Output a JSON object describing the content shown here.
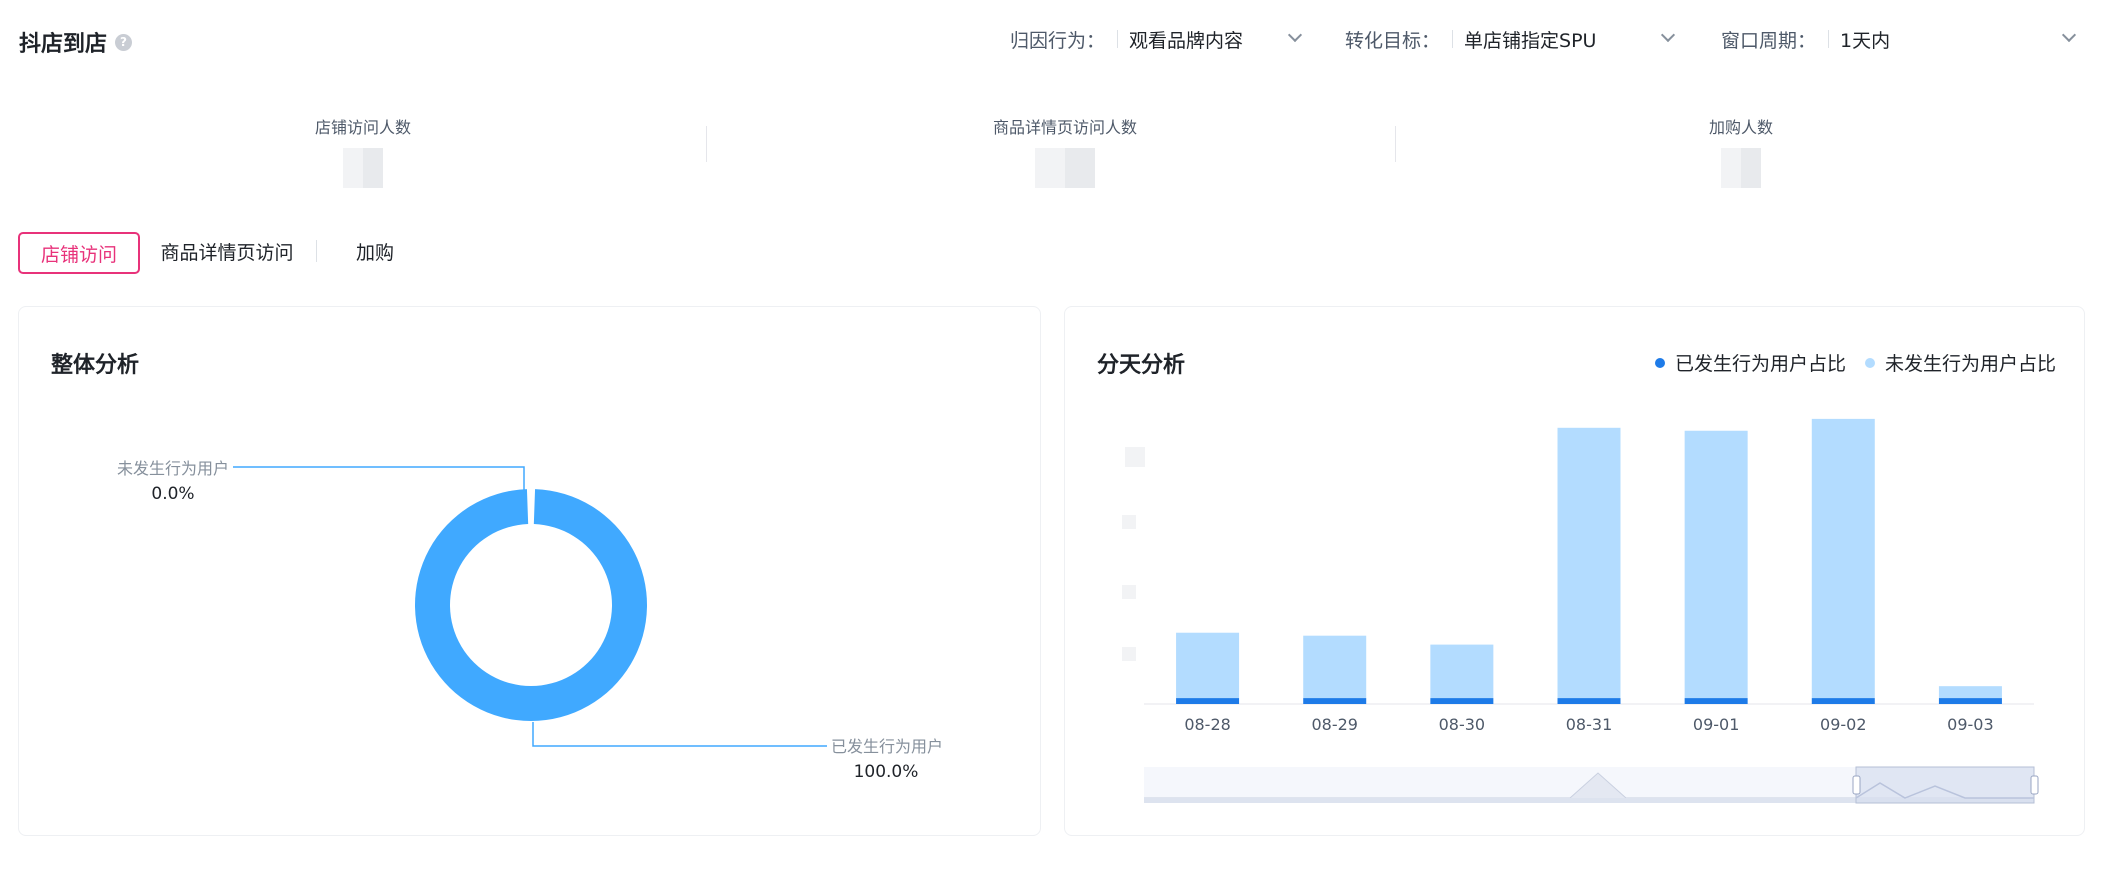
{
  "header": {
    "title": "抖店到店",
    "help_icon": "question-circle-icon"
  },
  "filters": [
    {
      "label": "归因行为：",
      "value": "观看品牌内容"
    },
    {
      "label": "转化目标：",
      "value": "单店铺指定SPU"
    },
    {
      "label": "窗口周期：",
      "value": "1天内"
    }
  ],
  "metrics": [
    {
      "label": "店铺访问人数"
    },
    {
      "label": "商品详情页访问人数"
    },
    {
      "label": "加购人数"
    }
  ],
  "tabs": [
    {
      "label": "店铺访问",
      "active": true
    },
    {
      "label": "商品详情页访问",
      "active": false
    },
    {
      "label": "加购",
      "active": false
    }
  ],
  "overall": {
    "title": "整体分析"
  },
  "daily": {
    "title": "分天分析"
  },
  "colors": {
    "accent": "#e8327a",
    "ring": "#40a9ff",
    "behavior": "#1e7be8",
    "no_behavior": "#b3dcff"
  },
  "chart_data": [
    {
      "type": "pie",
      "title": "整体分析",
      "slices": [
        {
          "name": "未发生行为用户",
          "value": 0.0,
          "label": "0.0%"
        },
        {
          "name": "已发生行为用户",
          "value": 100.0,
          "label": "100.0%"
        }
      ]
    },
    {
      "type": "bar",
      "title": "分天分析",
      "stacked": true,
      "categories": [
        "08-28",
        "08-29",
        "08-30",
        "08-31",
        "09-01",
        "09-02",
        "09-03"
      ],
      "series": [
        {
          "name": "已发生行为用户占比",
          "values": [
            2,
            2,
            2,
            2,
            2,
            2,
            2
          ]
        },
        {
          "name": "未发生行为用户占比",
          "values": [
            22,
            21,
            18,
            91,
            90,
            94,
            4
          ]
        }
      ],
      "legend": "top-right",
      "grid": false
    }
  ]
}
